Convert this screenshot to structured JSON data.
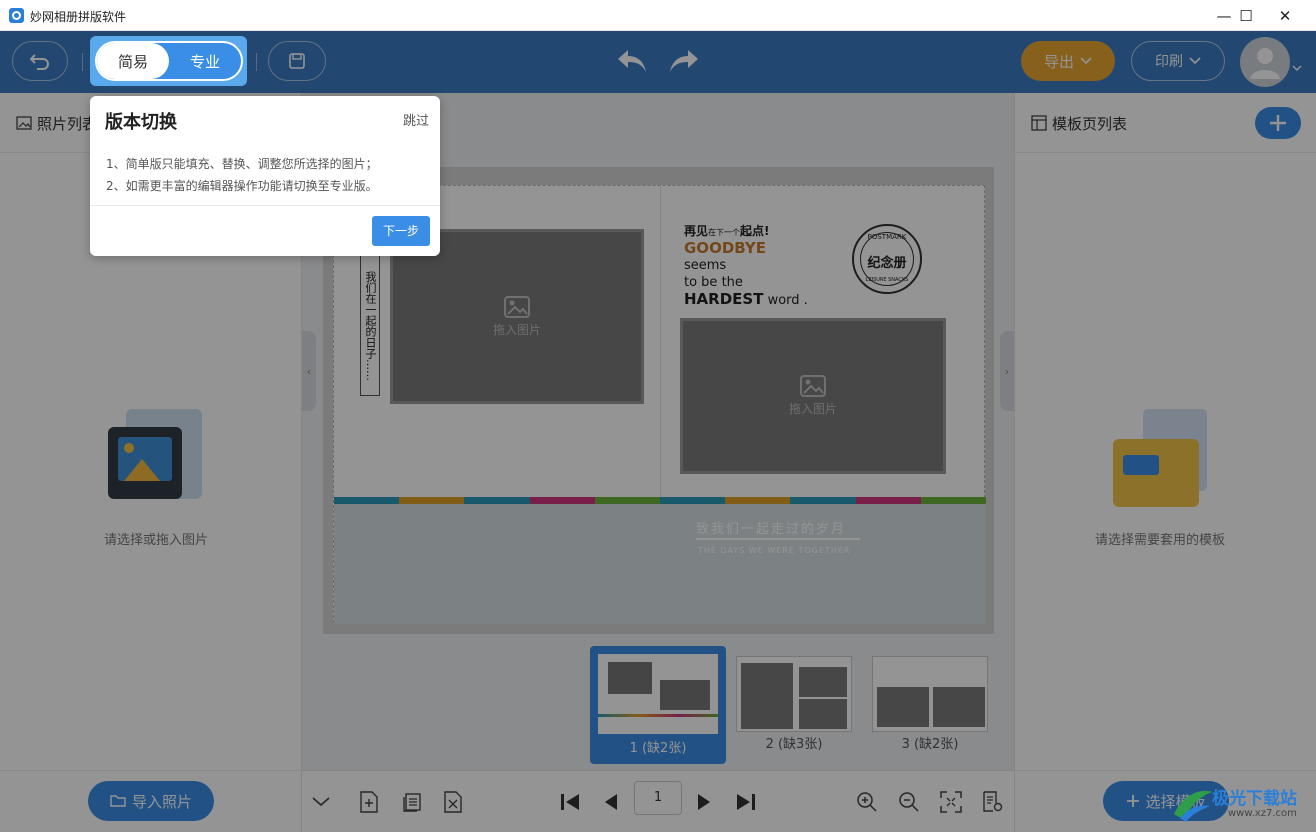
{
  "app": {
    "title": "妙网相册拼版软件"
  },
  "window": {
    "minimize": "—",
    "maximize": "☐",
    "close": "✕"
  },
  "toolbar": {
    "mode_simple": "简易",
    "mode_pro": "专业",
    "export_label": "导出",
    "print_label": "印刷"
  },
  "left_panel": {
    "title": "照片列表",
    "empty_text": "请选择或拖入图片",
    "import_button": "导入照片"
  },
  "right_panel": {
    "title": "模板页列表",
    "empty_text": "请选择需要套用的模板",
    "select_button": "选择模板"
  },
  "canvas": {
    "vertical_text": "我们在一起的日子……",
    "placeholder_label": "拖入图片",
    "headline_1": "再见",
    "headline_1_small": "在下一个",
    "headline_1_b": "起点!",
    "goodbye": "GOODBYE",
    "line2": "seems",
    "line3": "to be the",
    "hardest": "HARDEST",
    "word": "word .",
    "stamp_top": "POSTMARK",
    "stamp_center": "纪念册",
    "stamp_bottom": "LEISURE SNACKS",
    "banner_cn": "致我们一起走过的岁月",
    "banner_en": "THE DAYS WE WERE TOGETHER",
    "stripe_colors": [
      "#2a9bb8",
      "#e0a127",
      "#2a9bb8",
      "#d0347c",
      "#6cb13b",
      "#2a9bb8",
      "#e0a127",
      "#2a9bb8",
      "#d0347c",
      "#6cb13b"
    ]
  },
  "thumbnails": [
    {
      "label": "1 (缺2张)",
      "selected": true
    },
    {
      "label": "2 (缺3张)",
      "selected": false
    },
    {
      "label": "3 (缺2张)",
      "selected": false
    }
  ],
  "pager": {
    "current_page": "1"
  },
  "popup": {
    "title": "版本切换",
    "skip": "跳过",
    "line1": "1、简单版只能填充、替换、调整您所选择的图片；",
    "line2": "2、如需更丰富的编辑器操作功能请切换至专业版。",
    "next": "下一步"
  },
  "watermark": {
    "text": "极光下载站",
    "sub": "www.xz7.com"
  },
  "colors": {
    "toolbar": "#3b7cc4",
    "accent": "#3b8ee6",
    "export": "#e8a531"
  }
}
